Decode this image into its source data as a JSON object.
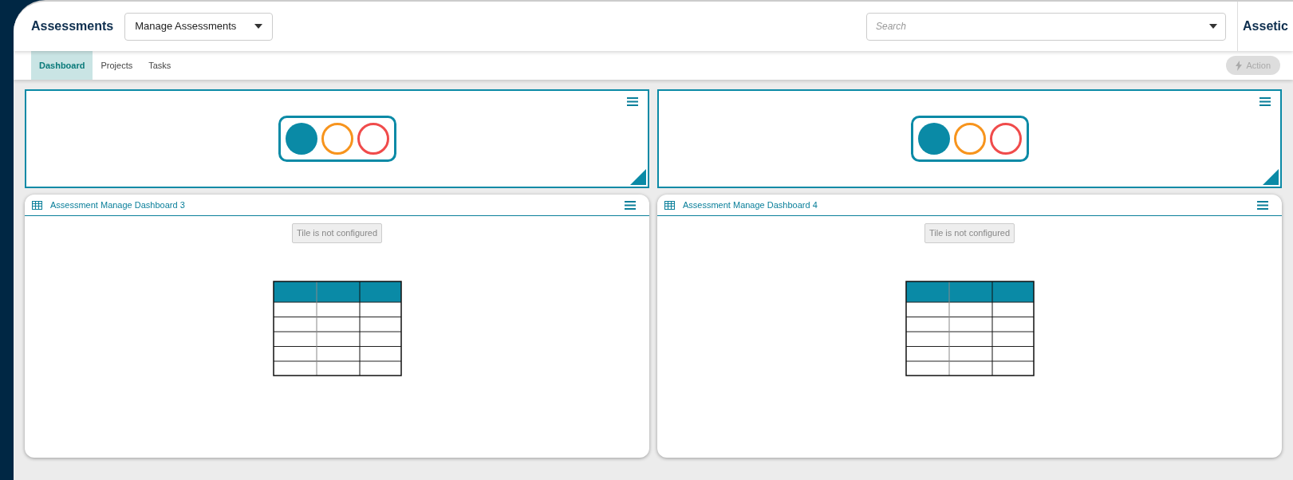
{
  "header": {
    "title": "Assessments",
    "module_select": "Manage Assessments",
    "search": {
      "placeholder": "Search"
    },
    "brand": "Assetic"
  },
  "tabs": [
    {
      "label": "Dashboard",
      "selected": true
    },
    {
      "label": "Projects",
      "selected": false
    },
    {
      "label": "Tasks",
      "selected": false
    }
  ],
  "action_button": {
    "label": "Action",
    "disabled": true
  },
  "tiles": [
    {
      "kind": "indicator"
    },
    {
      "kind": "indicator"
    },
    {
      "kind": "table",
      "title": "Assessment Manage Dashboard 3",
      "message": "Tile is not configured"
    },
    {
      "kind": "table",
      "title": "Assessment Manage Dashboard 4",
      "message": "Tile is not configured"
    }
  ]
}
